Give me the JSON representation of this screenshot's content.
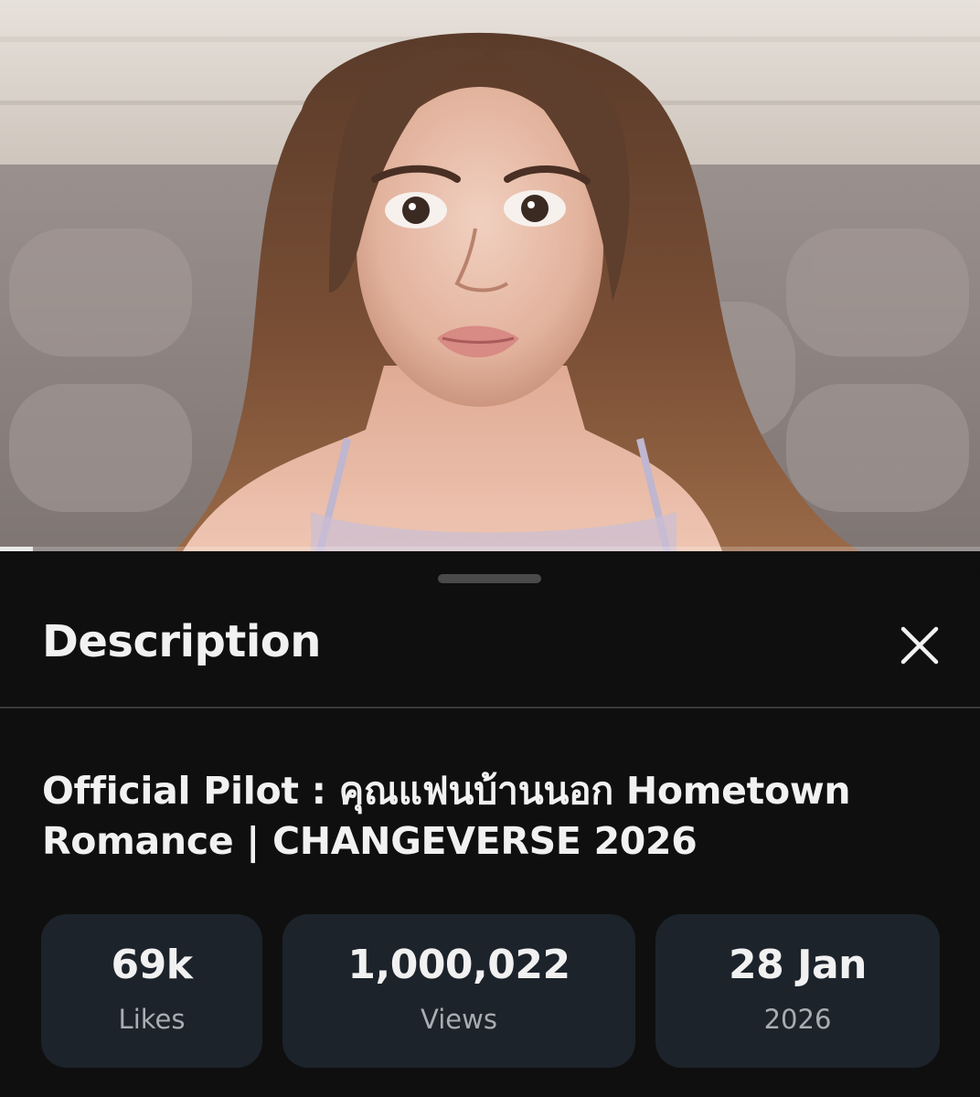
{
  "video": {
    "progress_fraction": 0.034,
    "colors": {
      "progress_played": "#e9e9e9",
      "sheet_background": "#0f0f0f",
      "stat_card_background": "#1d232b"
    }
  },
  "sheet": {
    "title": "Description",
    "close_icon": "close-icon",
    "video_title": "Official Pilot : คุณแฟนบ้านนอก Hometown Romance | CHANGEVERSE 2026",
    "stats": {
      "likes": {
        "value": "69k",
        "label": "Likes"
      },
      "views": {
        "value": "1,000,022",
        "label": "Views"
      },
      "date": {
        "value": "28 Jan",
        "label": "2026"
      }
    }
  }
}
